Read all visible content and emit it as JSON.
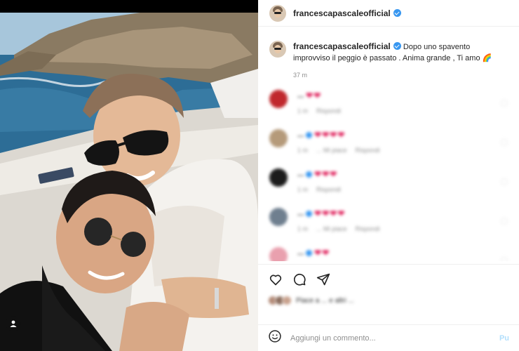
{
  "post": {
    "username": "francescapascaleofficial",
    "verified": true,
    "tag_icon": "user-tag-icon"
  },
  "caption": {
    "username": "francescapascaleofficial",
    "text": "Dopo uno spavento improvviso il peggio è passato . Anima grande , Ti amo 🌈",
    "time": "37 m"
  },
  "comments": [
    {
      "user": "...",
      "text": "❤❤",
      "avatar_color": "#c0282d",
      "verified": false,
      "meta": [
        "1 m",
        "Rispondi"
      ]
    },
    {
      "user": "...",
      "text": "❤❤❤❤",
      "avatar_color": "#b59a7a",
      "verified": true,
      "meta": [
        "1 m",
        "... Mi piace",
        "Rispondi"
      ]
    },
    {
      "user": "...",
      "text": "❤❤❤",
      "avatar_color": "#1c1c1c",
      "verified": true,
      "meta": [
        "1 m",
        "Rispondi"
      ]
    },
    {
      "user": "...",
      "text": "❤❤❤❤",
      "avatar_color": "#6f7f8f",
      "verified": true,
      "meta": [
        "1 m",
        "... Mi piace",
        "Rispondi"
      ]
    },
    {
      "user": "...",
      "text": "❤❤",
      "avatar_color": "#e9a0ae",
      "verified": true,
      "meta": [
        "1 m",
        "Rispondi"
      ]
    }
  ],
  "actions": {
    "like_icon": "heart-icon",
    "comment_icon": "comment-icon",
    "share_icon": "share-icon",
    "likes_text": "Piace a ... e altri ..."
  },
  "add_comment": {
    "placeholder": "Aggiungi un commento...",
    "post_label": "Pu"
  },
  "colors": {
    "accent": "#3897f0",
    "heart": "#e0245e",
    "post_button": "#b2dffc"
  }
}
